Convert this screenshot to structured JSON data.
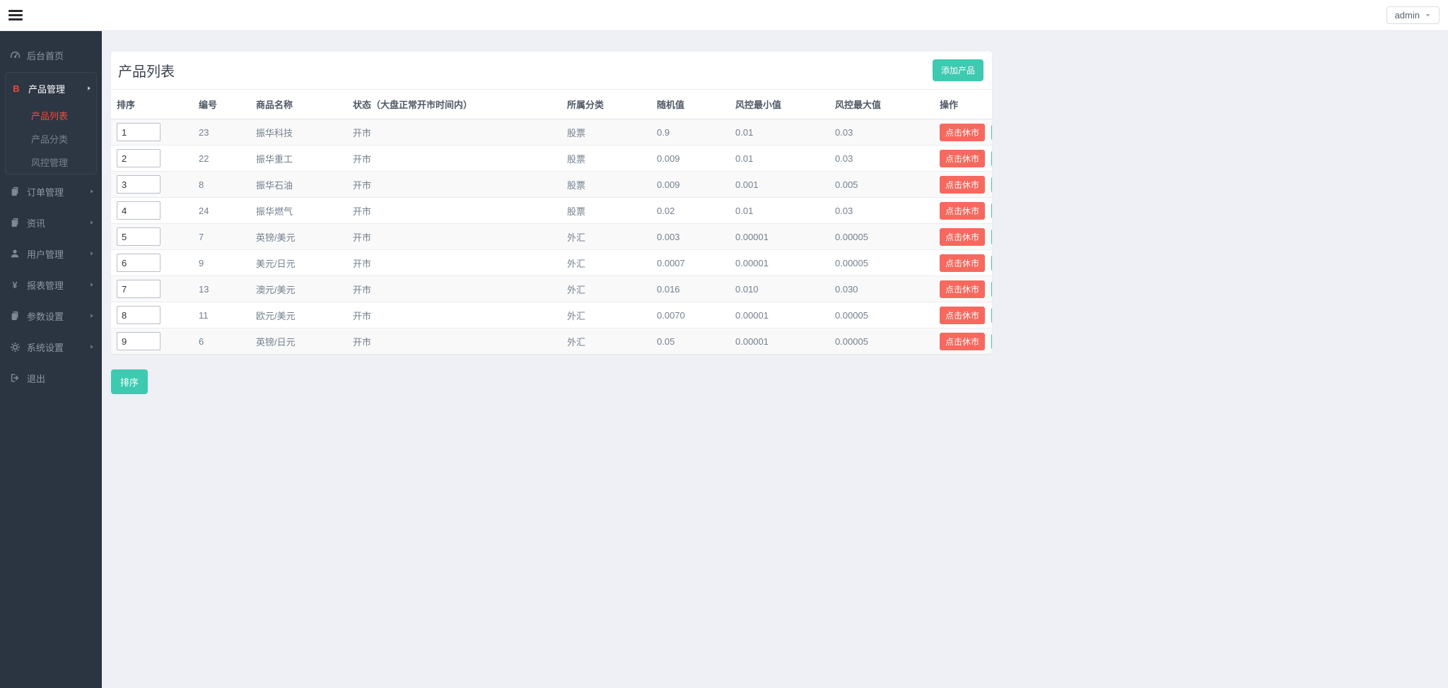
{
  "topbar": {
    "user": "admin",
    "user_caret_icon": "caret-down-icon",
    "menu_icon": "hamburger-icon"
  },
  "sidebar": {
    "items": [
      {
        "key": "dashboard-home",
        "label": "后台首页",
        "icon": "dashboard-icon"
      },
      {
        "key": "product-management",
        "label": "产品管理",
        "icon": "bitcoin-icon",
        "icon_color": "#f2483d",
        "expanded": true,
        "children": [
          {
            "key": "product-list",
            "label": "产品列表",
            "active": true
          },
          {
            "key": "product-category",
            "label": "产品分类",
            "active": false
          },
          {
            "key": "risk-management",
            "label": "风控管理",
            "active": false
          }
        ]
      },
      {
        "key": "order-management",
        "label": "订单管理",
        "icon": "files-icon",
        "caret": true
      },
      {
        "key": "news",
        "label": "资讯",
        "icon": "files-icon",
        "caret": true
      },
      {
        "key": "user-management",
        "label": "用户管理",
        "icon": "user-icon",
        "caret": true
      },
      {
        "key": "report-management",
        "label": "报表管理",
        "icon": "yen-icon",
        "caret": true
      },
      {
        "key": "parameter-settings",
        "label": "参数设置",
        "icon": "files-icon",
        "caret": true
      },
      {
        "key": "system-settings",
        "label": "系统设置",
        "icon": "gear-icon",
        "caret": true
      },
      {
        "key": "logout",
        "label": "退出",
        "icon": "logout-icon"
      }
    ]
  },
  "panel": {
    "title": "产品列表",
    "add_button_label": "添加产品",
    "table": {
      "headers": [
        "排序",
        "编号",
        "商品名称",
        "状态（大盘正常开市时间内）",
        "所属分类",
        "随机值",
        "风控最小值",
        "风控最大值",
        "操作"
      ],
      "actions": {
        "close_label": "点击休市",
        "edit_icon": "pencil-icon",
        "delete_icon": "trash-icon"
      },
      "rows": [
        {
          "sort": "1",
          "id": "23",
          "name": "振华科技",
          "status": "开市",
          "category": "股票",
          "random": "0.9",
          "risk_min": "0.01",
          "risk_max": "0.03"
        },
        {
          "sort": "2",
          "id": "22",
          "name": "振华重工",
          "status": "开市",
          "category": "股票",
          "random": "0.009",
          "risk_min": "0.01",
          "risk_max": "0.03"
        },
        {
          "sort": "3",
          "id": "8",
          "name": "振华石油",
          "status": "开市",
          "category": "股票",
          "random": "0.009",
          "risk_min": "0.001",
          "risk_max": "0.005"
        },
        {
          "sort": "4",
          "id": "24",
          "name": "振华燃气",
          "status": "开市",
          "category": "股票",
          "random": "0.02",
          "risk_min": "0.01",
          "risk_max": "0.03"
        },
        {
          "sort": "5",
          "id": "7",
          "name": "英镑/美元",
          "status": "开市",
          "category": "外汇",
          "random": "0.003",
          "risk_min": "0.00001",
          "risk_max": "0.00005"
        },
        {
          "sort": "6",
          "id": "9",
          "name": "美元/日元",
          "status": "开市",
          "category": "外汇",
          "random": "0.0007",
          "risk_min": "0.00001",
          "risk_max": "0.00005"
        },
        {
          "sort": "7",
          "id": "13",
          "name": "澳元/美元",
          "status": "开市",
          "category": "外汇",
          "random": "0.016",
          "risk_min": "0.010",
          "risk_max": "0.030"
        },
        {
          "sort": "8",
          "id": "11",
          "name": "欧元/美元",
          "status": "开市",
          "category": "外汇",
          "random": "0.0070",
          "risk_min": "0.00001",
          "risk_max": "0.00005"
        },
        {
          "sort": "9",
          "id": "6",
          "name": "英镑/日元",
          "status": "开市",
          "category": "外汇",
          "random": "0.05",
          "risk_min": "0.00001",
          "risk_max": "0.00005"
        }
      ]
    }
  },
  "footer": {
    "sort_button_label": "排序"
  },
  "colors": {
    "accent_teal": "#3ecab1",
    "accent_red": "#f7685e",
    "sidebar_bg": "#2b3541",
    "active_menu_red": "#f2483d",
    "page_bg": "#eef0f5"
  }
}
